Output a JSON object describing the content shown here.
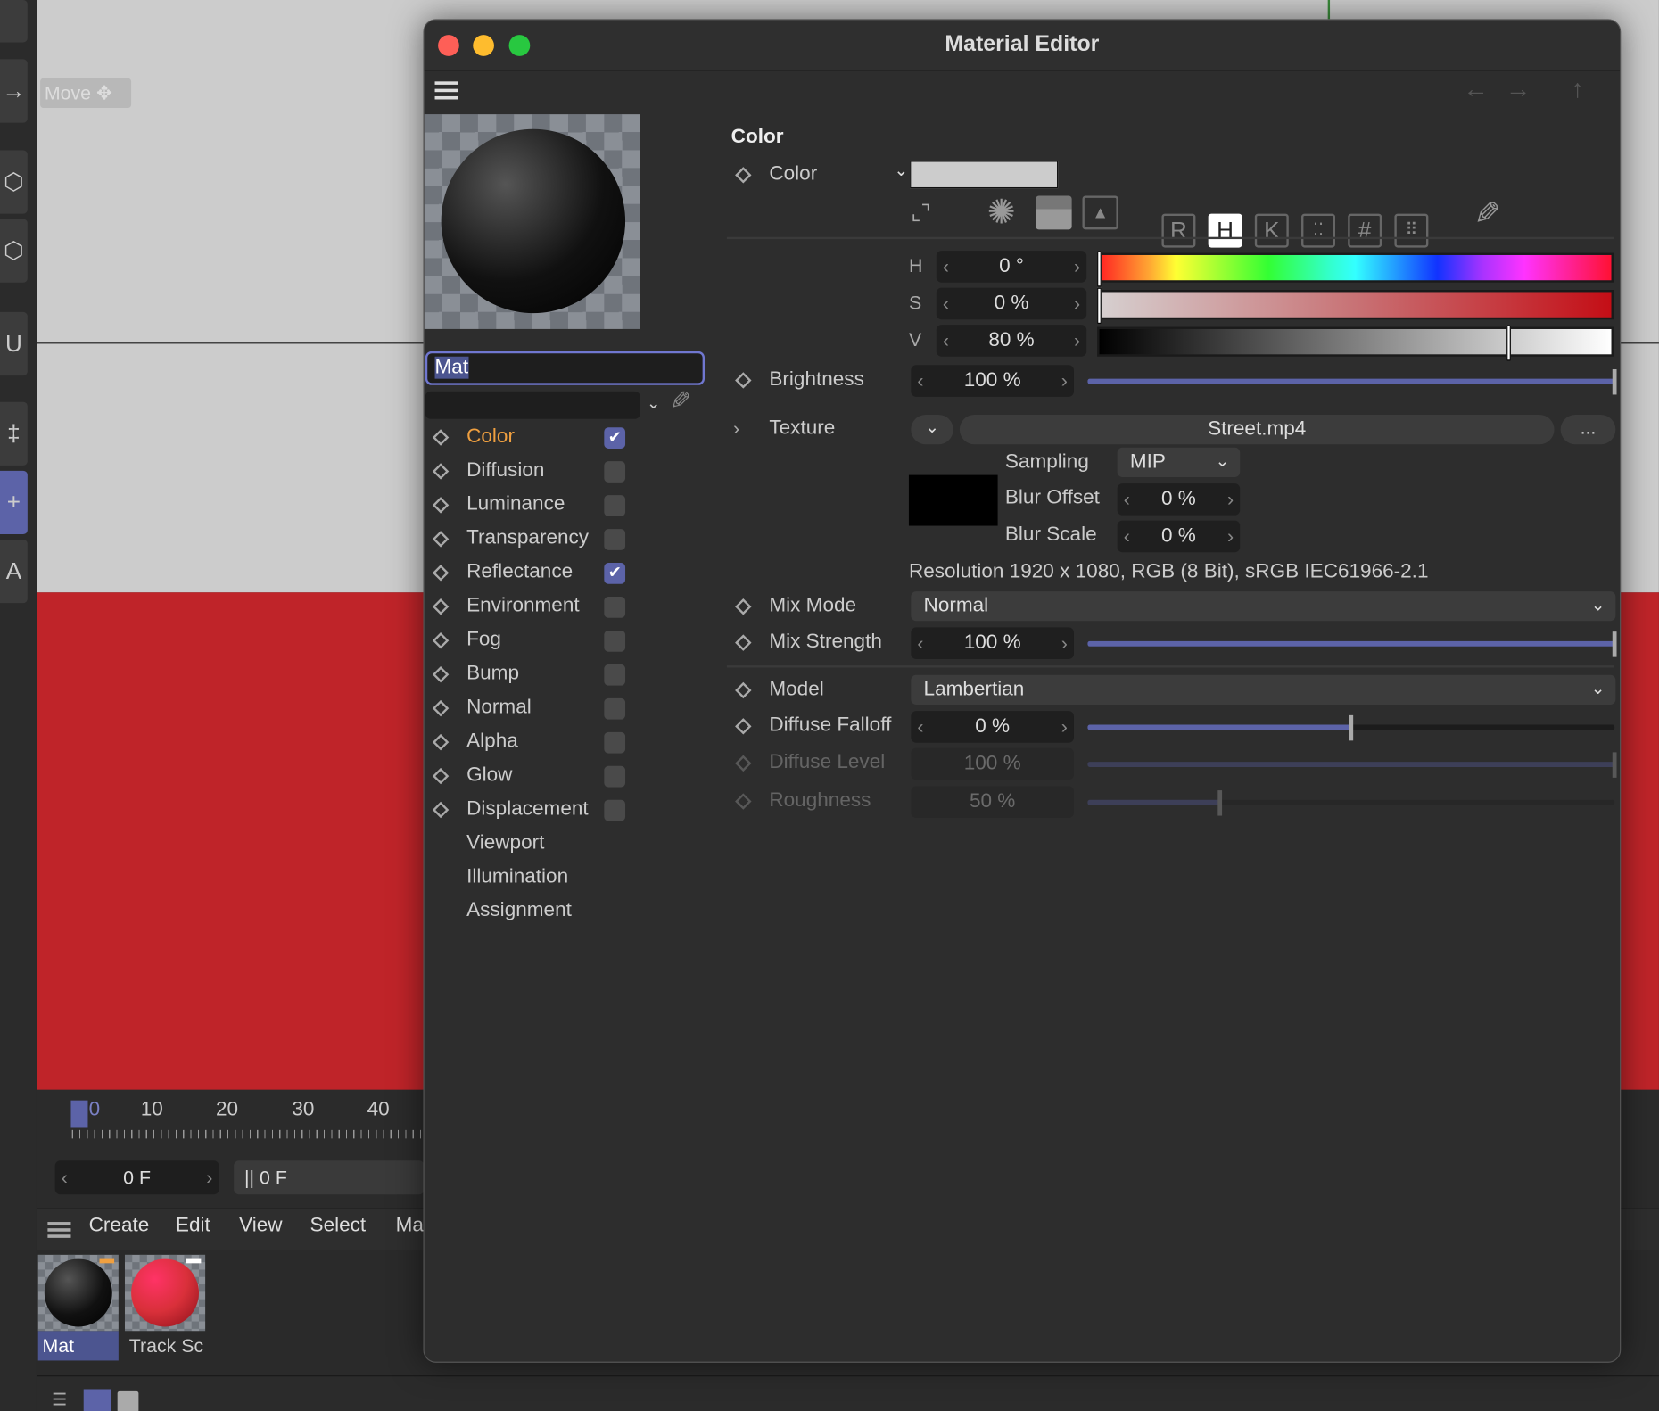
{
  "viewport": {
    "move_tag": "Move"
  },
  "timeline": {
    "ticks": [
      "0",
      "10",
      "20",
      "30",
      "40"
    ],
    "frame_current": "0 F",
    "frame_end": "|| 0 F"
  },
  "material_manager": {
    "menu": [
      "Create",
      "Edit",
      "View",
      "Select",
      "Ma"
    ],
    "materials": [
      {
        "name": "Mat",
        "color": "#111111",
        "selected": true
      },
      {
        "name": "Track Sc",
        "color": "#d9303a",
        "selected": false
      }
    ]
  },
  "window": {
    "title": "Material Editor",
    "material_name": "Mat",
    "channels": [
      {
        "label": "Color",
        "checked": true,
        "active": true
      },
      {
        "label": "Diffusion",
        "checked": false
      },
      {
        "label": "Luminance",
        "checked": false
      },
      {
        "label": "Transparency",
        "checked": false
      },
      {
        "label": "Reflectance",
        "checked": true
      },
      {
        "label": "Environment",
        "checked": false
      },
      {
        "label": "Fog",
        "checked": false
      },
      {
        "label": "Bump",
        "checked": false
      },
      {
        "label": "Normal",
        "checked": false
      },
      {
        "label": "Alpha",
        "checked": false
      },
      {
        "label": "Glow",
        "checked": false
      },
      {
        "label": "Displacement",
        "checked": false
      },
      {
        "label": "Viewport"
      },
      {
        "label": "Illumination"
      },
      {
        "label": "Assignment"
      }
    ],
    "section_title": "Color",
    "color": {
      "label": "Color",
      "swatch": "#cccccc",
      "modes": [
        "R",
        "H",
        "K",
        "#"
      ],
      "active_mode": "H",
      "h": {
        "label": "H",
        "value": "0 °",
        "fraction": 0
      },
      "s": {
        "label": "S",
        "value": "0 %",
        "fraction": 0
      },
      "v": {
        "label": "V",
        "value": "80 %",
        "fraction": 0.8
      }
    },
    "brightness": {
      "label": "Brightness",
      "value": "100 %",
      "fraction": 1
    },
    "texture": {
      "label": "Texture",
      "file": "Street.mp4",
      "more": "...",
      "sampling_label": "Sampling",
      "sampling": "MIP",
      "blur_offset_label": "Blur Offset",
      "blur_offset": "0 %",
      "blur_scale_label": "Blur Scale",
      "blur_scale": "0 %",
      "resolution": "Resolution 1920 x 1080, RGB (8 Bit), sRGB IEC61966-2.1"
    },
    "mix_mode": {
      "label": "Mix Mode",
      "value": "Normal"
    },
    "mix_strength": {
      "label": "Mix Strength",
      "value": "100 %",
      "fraction": 1
    },
    "model": {
      "label": "Model",
      "value": "Lambertian"
    },
    "diffuse_falloff": {
      "label": "Diffuse Falloff",
      "value": "0 %",
      "fraction": 0.5
    },
    "diffuse_level": {
      "label": "Diffuse Level",
      "value": "100 %",
      "fraction": 1
    },
    "roughness": {
      "label": "Roughness",
      "value": "50 %",
      "fraction": 0.25
    }
  }
}
